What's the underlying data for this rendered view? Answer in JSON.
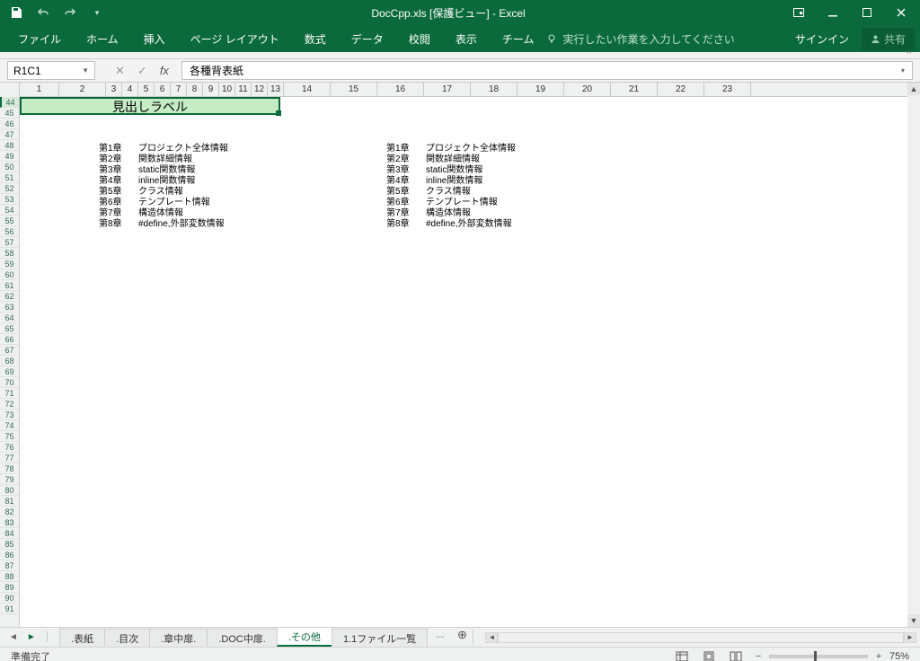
{
  "titlebar": {
    "app_title": "DocCpp.xls  [保護ビュー] - Excel"
  },
  "ribbon": {
    "tabs": [
      "ファイル",
      "ホーム",
      "挿入",
      "ページ レイアウト",
      "数式",
      "データ",
      "校閲",
      "表示",
      "チーム"
    ],
    "tell_me": "実行したい作業を入力してください",
    "signin": "サインイン",
    "share": "共有"
  },
  "formula_bar": {
    "namebox": "R1C1",
    "fx_label": "fx",
    "formula": "各種背表紙"
  },
  "grid": {
    "col_headers": [
      "1",
      "2",
      "3",
      "4",
      "5",
      "6",
      "7",
      "8",
      "9",
      "10",
      "11",
      "12",
      "13",
      "14",
      "15",
      "16",
      "17",
      "18",
      "19",
      "20",
      "21",
      "22",
      "23"
    ],
    "narrow_cols": [
      3,
      4,
      5,
      6,
      7,
      8,
      9,
      10,
      11,
      12,
      13
    ],
    "row_start": 44,
    "row_end": 91,
    "heading_label": "見出しラベル",
    "toc": [
      {
        "ch": "第1章",
        "title": "プロジェクト全体情報"
      },
      {
        "ch": "第2章",
        "title": "関数詳細情報"
      },
      {
        "ch": "第3章",
        "title": "static関数情報"
      },
      {
        "ch": "第4章",
        "title": "inline関数情報"
      },
      {
        "ch": "第5章",
        "title": "クラス情報"
      },
      {
        "ch": "第6章",
        "title": "テンプレート情報"
      },
      {
        "ch": "第7章",
        "title": "構造体情報"
      },
      {
        "ch": "第8章",
        "title": "#define,外部変数情報"
      }
    ]
  },
  "sheet_tabs": {
    "tabs": [
      ".表紙",
      ".目次",
      ".章中扉.",
      ".DOC中扉.",
      ".その他",
      "1.1ファイル一覧"
    ],
    "active_index": 4,
    "more": "..."
  },
  "status": {
    "ready": "準備完了",
    "zoom": "75%"
  }
}
